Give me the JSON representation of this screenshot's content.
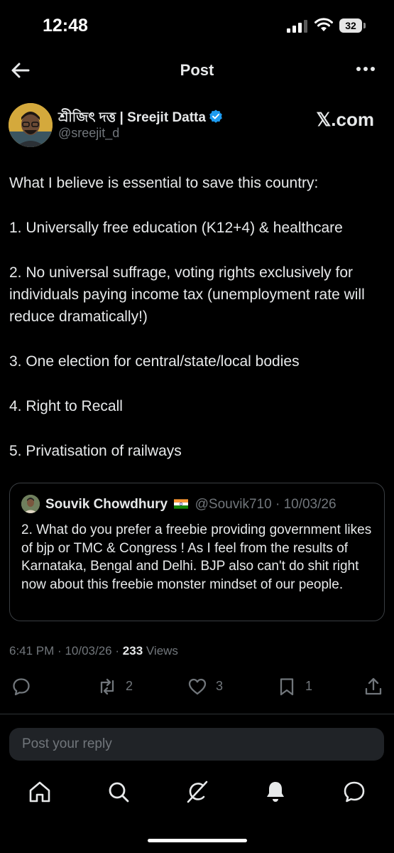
{
  "status": {
    "time": "12:48",
    "battery": "32"
  },
  "nav": {
    "title": "Post",
    "back_icon": "arrow-left-icon",
    "more_icon": "more-icon"
  },
  "author": {
    "name": "শ্রীজিৎ দত্ত | Sreejit Datta",
    "handle": "@sreejit_d",
    "site": "𝕏.com",
    "verified_color": "#1d9bf0"
  },
  "post": {
    "paragraphs": [
      "What I believe is essential to save this country:",
      "1. Universally free education (K12+4) & healthcare",
      "2. No universal suffrage, voting rights exclusively for individuals paying income tax (unemployment rate will reduce dramatically!)",
      "3. One election for central/state/local bodies",
      "4. Right to Recall",
      "5. Privatisation of railways"
    ]
  },
  "quote": {
    "name": "Souvik Chowdhury",
    "handle": "@Souvik710",
    "date": "10/03/26",
    "separator": "·",
    "text": "2. What do you prefer a freebie providing  government likes of bjp or TMC & Congress ! As I feel from the results of Karnataka, Bengal and Delhi. BJP also can't do shit right now about this freebie monster mindset of our people."
  },
  "meta": {
    "time": "6:41 PM",
    "date": "10/03/26",
    "separator": "·",
    "views_count": "233",
    "views_label": "Views"
  },
  "actions": {
    "reply_count": "",
    "repost_count": "2",
    "like_count": "3",
    "bookmark_count": "1"
  },
  "reply": {
    "placeholder": "Post your reply"
  },
  "tabs": [
    "home-icon",
    "search-icon",
    "grok-icon",
    "notifications-icon",
    "messages-icon"
  ],
  "colors": {
    "background": "#000000",
    "text": "#e7e9ea",
    "muted": "#71767b",
    "accent": "#1d9bf0"
  }
}
